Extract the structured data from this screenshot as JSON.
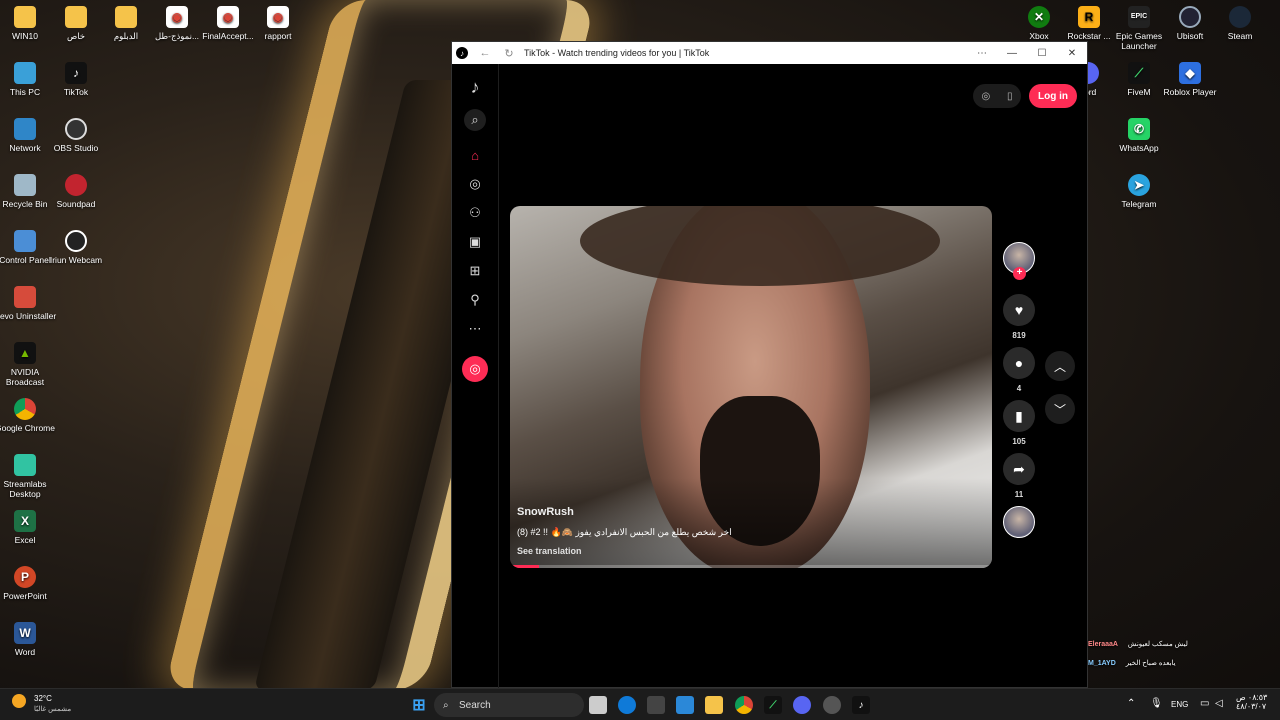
{
  "desktop": {
    "top_row": [
      {
        "label": "WIN10",
        "icon": "folder-icon"
      },
      {
        "label": "خاص",
        "icon": "folder-icon"
      },
      {
        "label": "الدبلوم",
        "icon": "folder-icon"
      },
      {
        "label": "نموذج-طل...",
        "icon": "chrome-doc-icon"
      },
      {
        "label": "FinalAccept...",
        "icon": "chrome-doc-icon"
      },
      {
        "label": "rapport",
        "icon": "chrome-doc-icon"
      }
    ],
    "left_col1": [
      {
        "label": "This PC",
        "icon": "monitor-icon"
      },
      {
        "label": "Network",
        "icon": "network-icon"
      },
      {
        "label": "Recycle Bin",
        "icon": "recycle-bin-icon"
      },
      {
        "label": "Control Panel",
        "icon": "control-panel-icon"
      },
      {
        "label": "Revo Uninstaller",
        "icon": "revo-icon"
      },
      {
        "label": "NVIDIA Broadcast",
        "icon": "nvidia-icon"
      },
      {
        "label": "Google Chrome",
        "icon": "chrome-icon"
      },
      {
        "label": "Streamlabs Desktop",
        "icon": "streamlabs-icon"
      },
      {
        "label": "Excel",
        "icon": "excel-icon"
      },
      {
        "label": "PowerPoint",
        "icon": "powerpoint-icon"
      },
      {
        "label": "Word",
        "icon": "word-icon"
      }
    ],
    "left_col2": [
      {
        "label": "TikTok",
        "icon": "tiktok-icon"
      },
      {
        "label": "OBS Studio",
        "icon": "obs-icon"
      },
      {
        "label": "Soundpad",
        "icon": "soundpad-icon"
      },
      {
        "label": "Iriun Webcam",
        "icon": "webcam-icon"
      }
    ],
    "right_top": [
      {
        "label": "Xbox",
        "icon": "xbox-icon"
      },
      {
        "label": "Rockstar ...",
        "icon": "rockstar-icon"
      },
      {
        "label": "Epic Games Launcher",
        "icon": "epic-icon"
      },
      {
        "label": "Ubisoft",
        "icon": "ubisoft-icon"
      },
      {
        "label": "Steam",
        "icon": "steam-icon"
      }
    ],
    "right_col": [
      {
        "label": "cord",
        "icon": "discord-icon"
      },
      {
        "label": "FiveM",
        "icon": "fivem-icon"
      },
      {
        "label": "Roblox Player",
        "icon": "roblox-icon"
      },
      {
        "label": "WhatsApp",
        "icon": "whatsapp-icon"
      },
      {
        "label": "Telegram",
        "icon": "telegram-icon"
      }
    ]
  },
  "window": {
    "title": "TikTok - Watch trending videos for you | TikTok",
    "controls": {
      "more": "⋯",
      "minimize": "—",
      "maximize": "☐",
      "close": "✕"
    }
  },
  "tiktok": {
    "login_label": "Log in",
    "sidebar_icons": [
      "tiktok-logo-icon",
      "search-icon",
      "home-icon",
      "explore-icon",
      "following-icon",
      "live-icon",
      "upload-icon",
      "profile-icon",
      "more-icon"
    ],
    "video": {
      "author": "SnowRush",
      "description": "(8)   #2 !! 🔥🙈 اخر شخص يطلع من الحبس الانفرادي يفوز",
      "translate_label": "See translation",
      "progress": 0.06
    },
    "actions": {
      "likes": "819",
      "comments": "4",
      "saves": "105",
      "shares": "11"
    }
  },
  "taskbar": {
    "weather_temp": "32°C",
    "weather_desc": "مشمس غالبًا",
    "search_placeholder": "Search",
    "lang": "ENG",
    "time": "٠٨:٥٣ ص",
    "date": "٤٨/٠٣/٠٧"
  },
  "overlay_chat": [
    {
      "user": "EleraaaA",
      "text": "ليش مسكب لعيونش"
    },
    {
      "user": "M_1AYD",
      "text": "يابعده صباح الخير"
    }
  ]
}
